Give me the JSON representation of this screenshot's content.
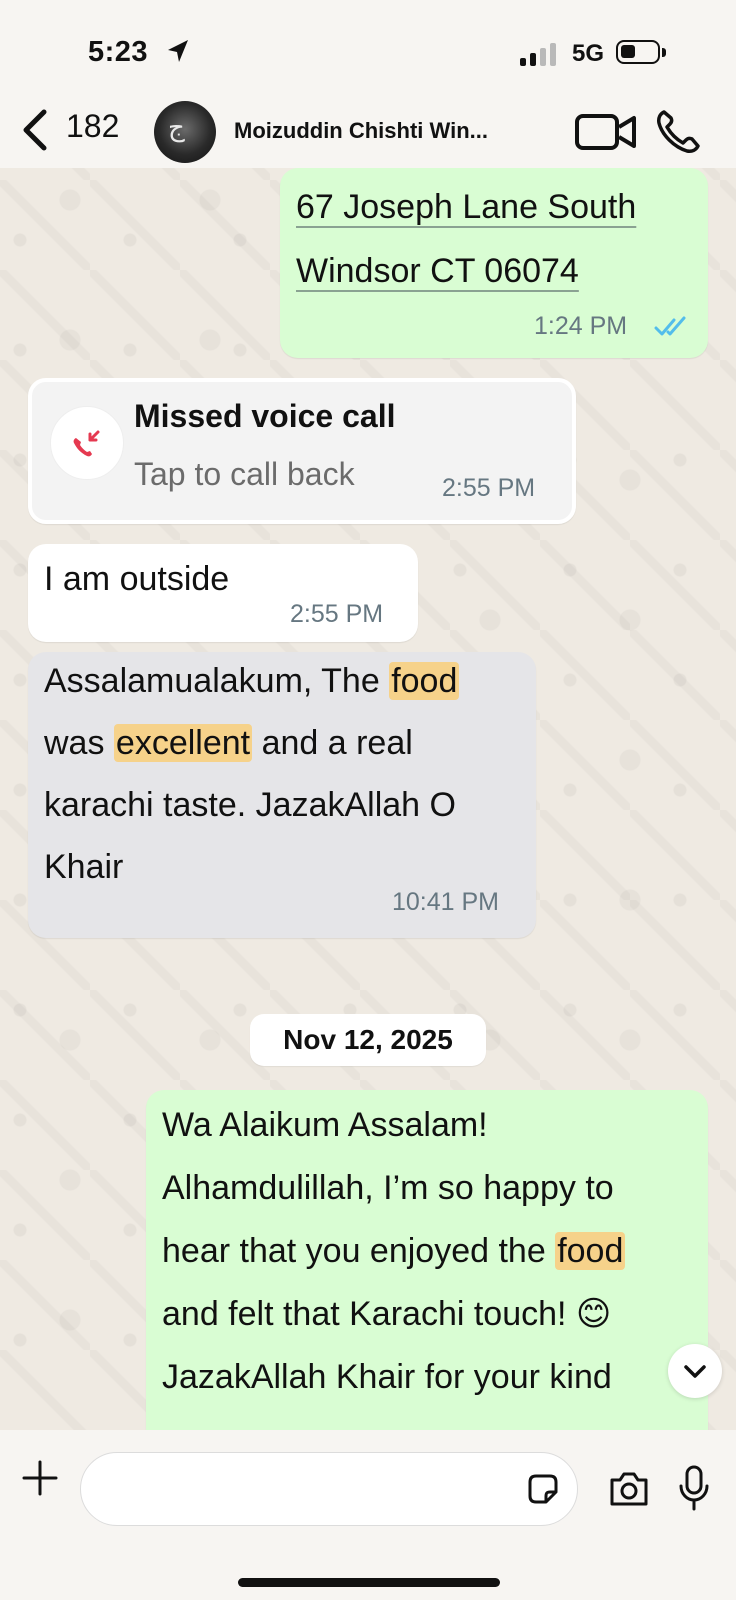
{
  "status_bar": {
    "time": "5:23",
    "network": "5G"
  },
  "header": {
    "back_count": "182",
    "contact_name": "Moizuddin Chishti Win..."
  },
  "messages": [
    {
      "direction": "outgoing",
      "lines": [
        "67 Joseph Lane South",
        "Windsor CT 06074"
      ],
      "time": "1:24 PM",
      "status": "read"
    },
    {
      "direction": "incoming",
      "type": "missed_call",
      "title": "Missed voice call",
      "subtitle": "Tap to call back",
      "time": "2:55 PM"
    },
    {
      "direction": "incoming",
      "text": "I am outside",
      "time": "2:55 PM"
    },
    {
      "direction": "incoming",
      "lines": [
        "Assalamualakum, The food",
        "was excellent and a real",
        "karachi taste. JazakAllah O",
        "Khair"
      ],
      "highlights": [
        "food",
        "excellent"
      ],
      "time": "10:41 PM"
    },
    {
      "direction": "outgoing",
      "lines": [
        "Wa Alaikum Assalam!",
        "Alhamdulillah, I’m so happy to",
        "hear that you enjoyed the food",
        "and felt that Karachi touch! 😊",
        "JazakAllah Khair for your kind"
      ],
      "highlights": [
        "food"
      ]
    }
  ],
  "date_separator": "Nov 12, 2025",
  "colors": {
    "outgoing_bubble": "#d9fdd3",
    "incoming_bubble": "#ffffff",
    "highlight": "#f6d28a",
    "read_ticks": "#53bdeb",
    "missed_call_red": "#e53950",
    "wallpaper": "#efeae2"
  },
  "icons": {
    "back": "chevron-left-icon",
    "video": "video-camera-icon",
    "phone": "phone-icon",
    "missed_call": "missed-call-icon",
    "scroll_down": "chevron-down-icon",
    "attach": "plus-icon",
    "sticker": "sticker-icon",
    "camera": "camera-icon",
    "mic": "microphone-icon"
  }
}
